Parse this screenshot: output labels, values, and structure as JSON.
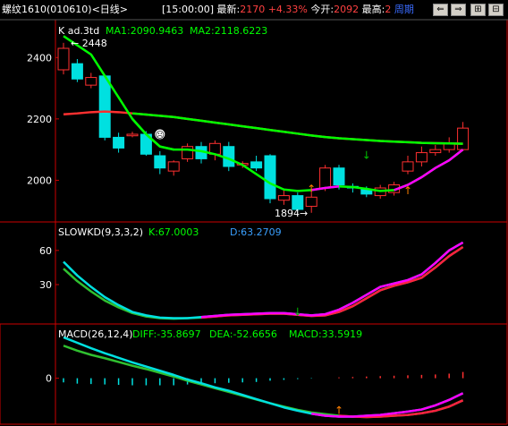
{
  "header": {
    "symbol": "螺纹1610",
    "code": "(010610)",
    "period": "<日线>",
    "time": "[15:00:00]",
    "latest_label": "最新:",
    "latest_value": "2170",
    "change": "+4.33%",
    "open_label": "今开:",
    "open_value": "2092",
    "high_label": "最高:",
    "high_value": "2",
    "cycle_link": "周期"
  },
  "toolbar": {
    "buttons": [
      {
        "name": "prev-button",
        "icon": "⇐"
      },
      {
        "name": "next-button",
        "icon": "⇒"
      },
      {
        "name": "zoom-in-button",
        "icon": "⊞"
      },
      {
        "name": "zoom-out-button",
        "icon": "⊟"
      }
    ]
  },
  "colors": {
    "up": "#ff3030",
    "down": "#00e0e0",
    "ma1": "#00ff00",
    "ma2": "#ff3030",
    "kd_k": "#00e0e0",
    "kd_d": "#30c030",
    "diff": "#00e0e0",
    "dea": "#30c030",
    "highlight": "#ff00ff",
    "axis": "#cc0000",
    "label": "#ffffff"
  },
  "chart_data": [
    {
      "type": "candlestick",
      "panel": "main",
      "indicator_text": "K  ad.3td",
      "legend": [
        {
          "name": "MA1",
          "text": "MA1:2090.9463"
        },
        {
          "name": "MA2",
          "text": "MA2:2118.6223"
        }
      ],
      "yticks": [
        2000,
        2200,
        2400
      ],
      "ylim": [
        1870,
        2500
      ],
      "annotations": [
        {
          "text": "2448",
          "x": 0,
          "y": 2448
        },
        {
          "text": "1894",
          "x": 18,
          "y": 1894
        }
      ],
      "candles": [
        {
          "o": 2360,
          "c": 2430,
          "h": 2448,
          "l": 2345
        },
        {
          "o": 2380,
          "c": 2330,
          "h": 2395,
          "l": 2320
        },
        {
          "o": 2310,
          "c": 2335,
          "h": 2350,
          "l": 2300
        },
        {
          "o": 2340,
          "c": 2140,
          "h": 2345,
          "l": 2130
        },
        {
          "o": 2140,
          "c": 2105,
          "h": 2155,
          "l": 2090
        },
        {
          "o": 2145,
          "c": 2150,
          "h": 2158,
          "l": 2140
        },
        {
          "o": 2150,
          "c": 2085,
          "h": 2160,
          "l": 2080
        },
        {
          "o": 2080,
          "c": 2040,
          "h": 2095,
          "l": 2020
        },
        {
          "o": 2030,
          "c": 2060,
          "h": 2065,
          "l": 2015
        },
        {
          "o": 2070,
          "c": 2110,
          "h": 2120,
          "l": 2060
        },
        {
          "o": 2110,
          "c": 2070,
          "h": 2125,
          "l": 2055
        },
        {
          "o": 2085,
          "c": 2120,
          "h": 2130,
          "l": 2065
        },
        {
          "o": 2110,
          "c": 2045,
          "h": 2125,
          "l": 2030
        },
        {
          "o": 2050,
          "c": 2055,
          "h": 2062,
          "l": 2040
        },
        {
          "o": 2060,
          "c": 2040,
          "h": 2080,
          "l": 2030
        },
        {
          "o": 2080,
          "c": 1940,
          "h": 2085,
          "l": 1925
        },
        {
          "o": 1935,
          "c": 1950,
          "h": 1970,
          "l": 1920
        },
        {
          "o": 1950,
          "c": 1905,
          "h": 1960,
          "l": 1900
        },
        {
          "o": 1915,
          "c": 1945,
          "h": 1960,
          "l": 1894
        },
        {
          "o": 1975,
          "c": 2040,
          "h": 2050,
          "l": 1965
        },
        {
          "o": 2040,
          "c": 1985,
          "h": 2050,
          "l": 1970
        },
        {
          "o": 1980,
          "c": 1975,
          "h": 1990,
          "l": 1960
        },
        {
          "o": 1970,
          "c": 1955,
          "h": 1980,
          "l": 1945
        },
        {
          "o": 1950,
          "c": 1975,
          "h": 1985,
          "l": 1940
        },
        {
          "o": 1960,
          "c": 1985,
          "h": 1995,
          "l": 1950
        },
        {
          "o": 2030,
          "c": 2060,
          "h": 2080,
          "l": 2020
        },
        {
          "o": 2060,
          "c": 2090,
          "h": 2110,
          "l": 2045
        },
        {
          "o": 2090,
          "c": 2100,
          "h": 2115,
          "l": 2080
        },
        {
          "o": 2100,
          "c": 2120,
          "h": 2140,
          "l": 2090
        },
        {
          "o": 2100,
          "c": 2170,
          "h": 2190,
          "l": 2095
        }
      ],
      "series": [
        {
          "name": "MA1",
          "values": [
            2470,
            2440,
            2410,
            2340,
            2270,
            2200,
            2150,
            2110,
            2100,
            2100,
            2095,
            2085,
            2070,
            2050,
            2020,
            1990,
            1970,
            1965,
            1968,
            1975,
            1980,
            1978,
            1972,
            1965,
            1968,
            1985,
            2010,
            2040,
            2065,
            2100
          ]
        },
        {
          "name": "MA2",
          "values": [
            2215,
            2218,
            2222,
            2224,
            2222,
            2218,
            2214,
            2210,
            2206,
            2200,
            2194,
            2188,
            2182,
            2176,
            2170,
            2164,
            2158,
            2152,
            2146,
            2141,
            2137,
            2134,
            2131,
            2128,
            2126,
            2124,
            2122,
            2121,
            2120,
            2119
          ]
        }
      ]
    },
    {
      "type": "line",
      "panel": "kd",
      "legend": [
        {
          "name": "SLOWKD",
          "text": "SLOWKD(9,3,3,2)"
        },
        {
          "name": "K",
          "text": "K:67.0003"
        },
        {
          "name": "D",
          "text": "D:63.2709"
        }
      ],
      "yticks": [
        30,
        60
      ],
      "ylim": [
        -3,
        74
      ],
      "series": [
        {
          "name": "K",
          "values": [
            50,
            38,
            28,
            19,
            12,
            6,
            3,
            1,
            0.5,
            0.5,
            1.5,
            2.5,
            3.5,
            4,
            4.5,
            5,
            5,
            4,
            3,
            4,
            8,
            14,
            21,
            28,
            31,
            34,
            39,
            49,
            60,
            67
          ]
        },
        {
          "name": "D",
          "values": [
            44,
            33,
            24,
            16,
            10,
            5,
            2,
            0.5,
            0,
            0.5,
            1,
            2,
            3,
            3.5,
            4,
            4.5,
            4.5,
            3.5,
            2.5,
            3,
            6,
            11,
            18,
            25,
            29,
            32,
            36,
            45,
            55,
            63
          ]
        }
      ]
    },
    {
      "type": "line",
      "panel": "macd",
      "legend": [
        {
          "name": "MACD",
          "text": "MACD(26,12,4)"
        },
        {
          "name": "DIFF",
          "text": "DIFF:-35.8697"
        },
        {
          "name": "DEA",
          "text": "DEA:-52.6656"
        },
        {
          "name": "MACD-value",
          "text": "MACD:33.5919"
        }
      ],
      "yticks": [
        0
      ],
      "ylim": [
        -106,
        100
      ],
      "series": [
        {
          "name": "DIFF",
          "values": [
            98,
            85,
            72,
            60,
            49,
            38,
            28,
            18,
            8,
            -3,
            -12,
            -22,
            -30,
            -40,
            -50,
            -60,
            -70,
            -78,
            -85,
            -90,
            -92,
            -92,
            -90,
            -88,
            -84,
            -80,
            -75,
            -65,
            -52,
            -36
          ]
        },
        {
          "name": "DEA",
          "values": [
            78,
            66,
            56,
            48,
            39,
            30,
            22,
            13,
            4,
            -6,
            -15,
            -24,
            -33,
            -42,
            -51,
            -60,
            -68,
            -76,
            -82,
            -86,
            -90,
            -92,
            -93,
            -92,
            -90,
            -88,
            -84,
            -78,
            -68,
            -53
          ]
        },
        {
          "name": "MACD",
          "values": [
            -10,
            -13,
            -14,
            -15,
            -16,
            -17,
            -17,
            -17,
            -17,
            -15,
            -13,
            -12,
            -11,
            -10,
            -9,
            -6,
            -4,
            -2,
            -1,
            0,
            2,
            3,
            4,
            5,
            6,
            7,
            8,
            9,
            11,
            15
          ]
        }
      ]
    }
  ]
}
